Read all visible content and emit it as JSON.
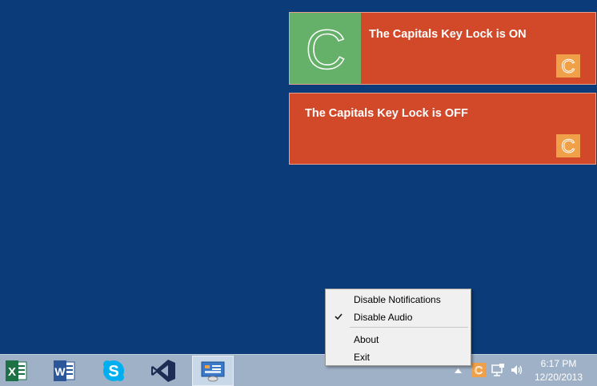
{
  "notifications": [
    {
      "title": "The Capitals Key Lock is ON",
      "big_letter": "C",
      "small_letter": "C"
    },
    {
      "title": "The Capitals Key Lock is OFF",
      "small_letter": "C"
    }
  ],
  "context_menu": {
    "items": [
      {
        "label": "Disable Notifications",
        "checked": false
      },
      {
        "label": "Disable Audio",
        "checked": true
      },
      {
        "label": "About",
        "checked": false
      },
      {
        "label": "Exit",
        "checked": false
      }
    ]
  },
  "taskbar": {
    "apps": [
      {
        "icon": "excel-icon"
      },
      {
        "icon": "word-icon"
      },
      {
        "icon": "skype-icon"
      },
      {
        "icon": "visual-studio-icon"
      },
      {
        "icon": "capslock-app-icon",
        "active": true
      }
    ],
    "tray": {
      "icons": [
        "show-hidden-icons-arrow",
        "capslock-tray-icon",
        "network-icon",
        "volume-icon"
      ]
    },
    "clock": {
      "time": "6:17 PM",
      "date": "12/20/2013"
    }
  },
  "colors": {
    "desktop": "#0b3b78",
    "toast": "#d2492a",
    "toast_tile": "#65b169",
    "tray_badge": "#f0a048",
    "taskbar": "#9fb1c6"
  }
}
